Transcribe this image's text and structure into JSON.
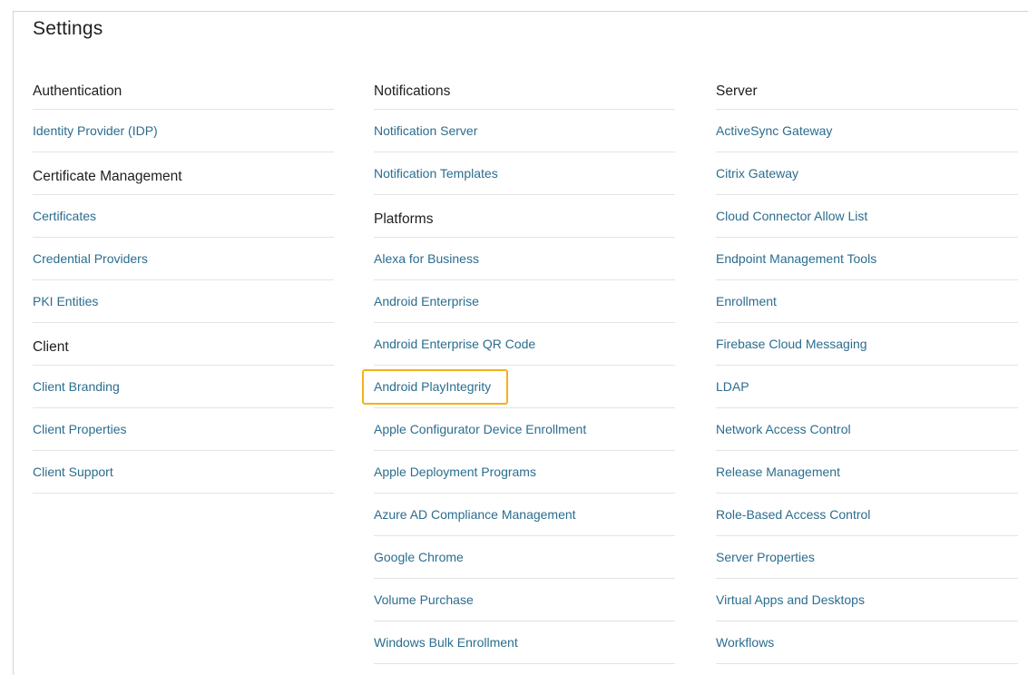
{
  "page": {
    "title": "Settings"
  },
  "columns": [
    {
      "sections": [
        {
          "header": "Authentication",
          "items": [
            "Identity Provider (IDP)"
          ]
        },
        {
          "header": "Certificate Management",
          "items": [
            "Certificates",
            "Credential Providers",
            "PKI Entities"
          ]
        },
        {
          "header": "Client",
          "items": [
            "Client Branding",
            "Client Properties",
            "Client Support"
          ]
        }
      ]
    },
    {
      "sections": [
        {
          "header": "Notifications",
          "items": [
            "Notification Server",
            "Notification Templates"
          ]
        },
        {
          "header": "Platforms",
          "items": [
            "Alexa for Business",
            "Android Enterprise",
            "Android Enterprise QR Code",
            "Android PlayIntegrity",
            "Apple Configurator Device Enrollment",
            "Apple Deployment Programs",
            "Azure AD Compliance Management",
            "Google Chrome",
            "Volume Purchase",
            "Windows Bulk Enrollment"
          ]
        }
      ]
    },
    {
      "sections": [
        {
          "header": "Server",
          "items": [
            "ActiveSync Gateway",
            "Citrix Gateway",
            "Cloud Connector Allow List",
            "Endpoint Management Tools",
            "Enrollment",
            "Firebase Cloud Messaging",
            "LDAP",
            "Network Access Control",
            "Release Management",
            "Role-Based Access Control",
            "Server Properties",
            "Virtual Apps and Desktops",
            "Workflows"
          ]
        }
      ]
    }
  ],
  "highlighted_item": "Android PlayIntegrity",
  "colors": {
    "link": "#2b6d8f",
    "heading": "#202020",
    "divider": "#e3e3e3",
    "highlight_border": "#f3b21b"
  }
}
